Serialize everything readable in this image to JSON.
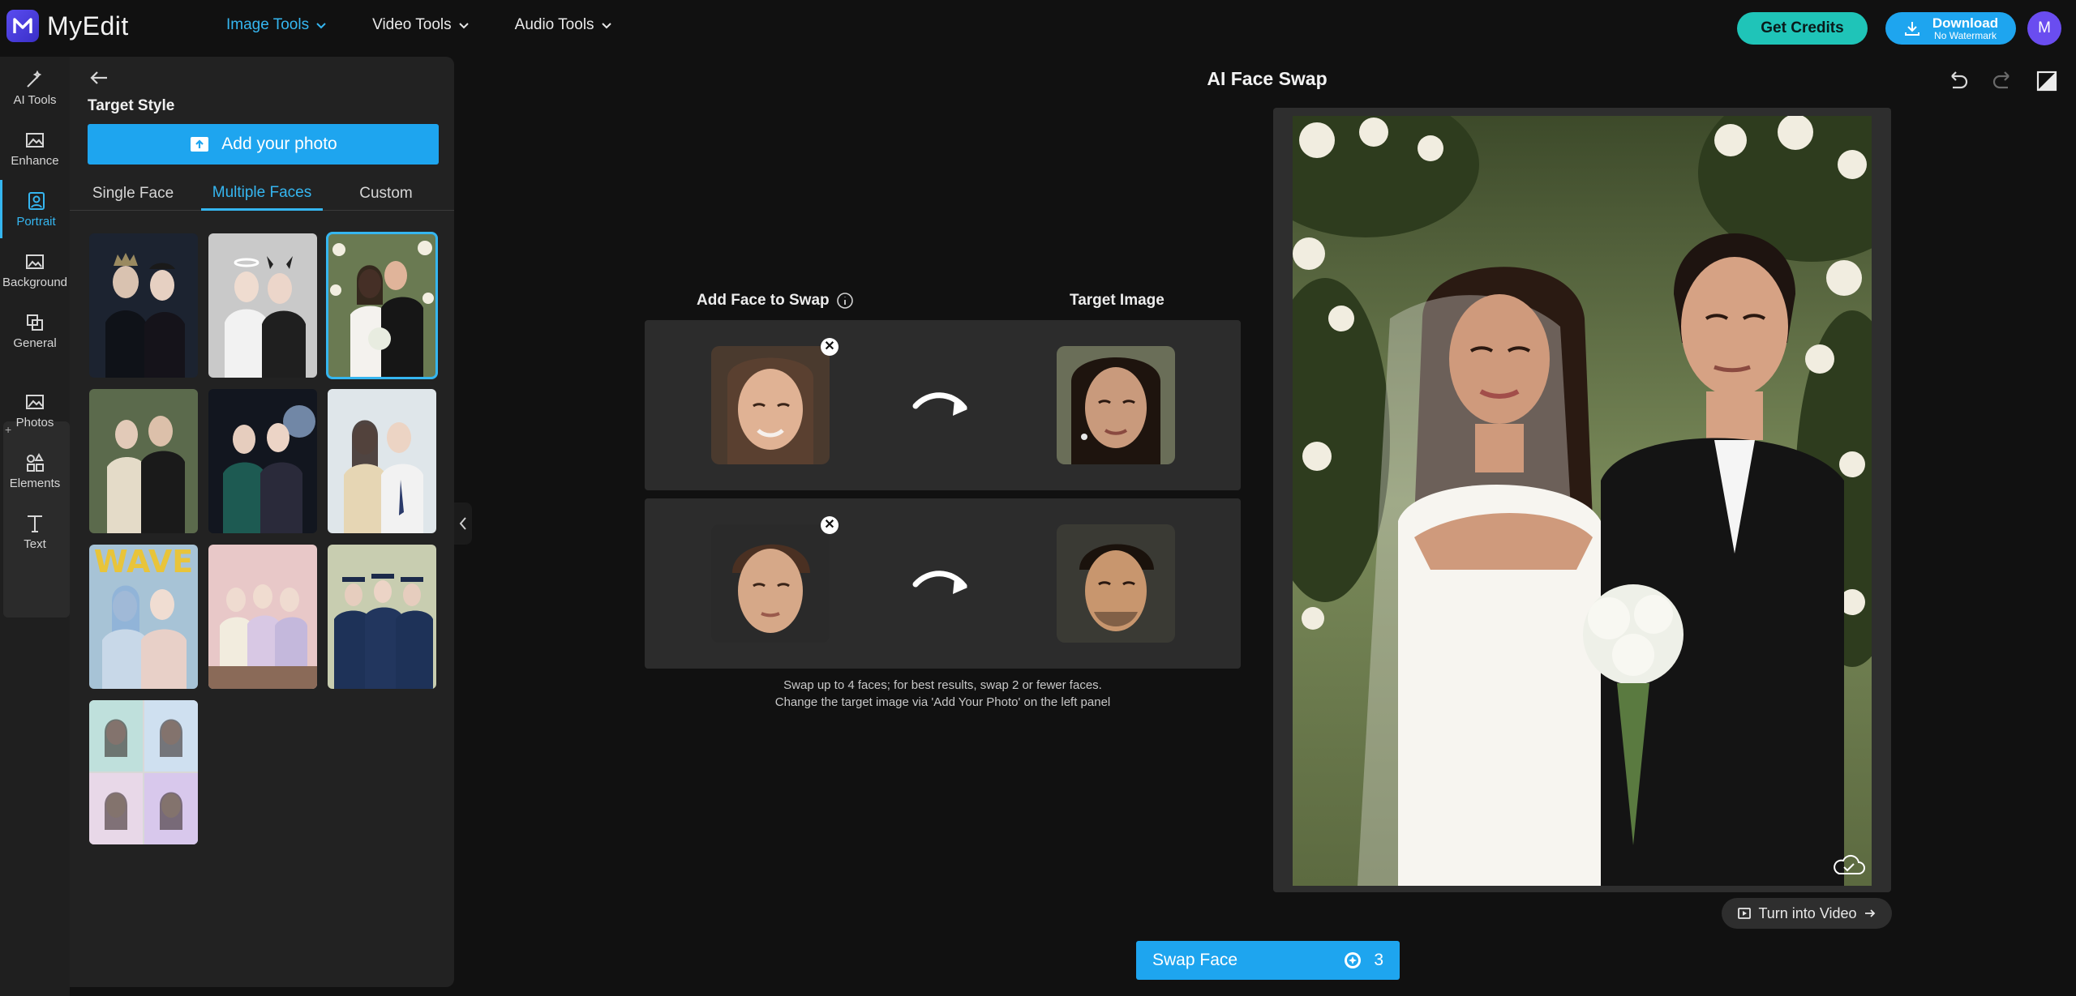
{
  "app": {
    "name": "MyEdit",
    "avatar_initial": "M"
  },
  "topnav": [
    {
      "label": "Image Tools",
      "active": true
    },
    {
      "label": "Video Tools",
      "active": false
    },
    {
      "label": "Audio Tools",
      "active": false
    }
  ],
  "header_actions": {
    "credits_label": "Get Credits",
    "download_label": "Download",
    "download_sublabel": "No Watermark"
  },
  "rail": [
    {
      "label": "AI Tools",
      "icon": "magic-wand-icon"
    },
    {
      "label": "Enhance",
      "icon": "enhance-image-icon"
    },
    {
      "label": "Portrait",
      "icon": "portrait-icon",
      "active": true
    },
    {
      "label": "Background",
      "icon": "background-icon"
    },
    {
      "label": "General",
      "icon": "general-icon"
    },
    {
      "label": "Photos",
      "icon": "photos-icon"
    },
    {
      "label": "Elements",
      "icon": "elements-icon"
    },
    {
      "label": "Text",
      "icon": "text-icon"
    }
  ],
  "rail_plus": "+",
  "panel": {
    "title": "Target Style",
    "add_photo_label": "Add your photo",
    "tabs": [
      {
        "label": "Single Face"
      },
      {
        "label": "Multiple Faces",
        "active": true
      },
      {
        "label": "Custom"
      }
    ],
    "thumbnails": [
      {
        "name": "dark-royal-couple"
      },
      {
        "name": "angel-devil-pair"
      },
      {
        "name": "wedding-couple",
        "selected": true
      },
      {
        "name": "vintage-couple"
      },
      {
        "name": "party-friends"
      },
      {
        "name": "school-uniform-pair"
      },
      {
        "name": "wave-group",
        "caption": "WAVE"
      },
      {
        "name": "schoolgirls-group"
      },
      {
        "name": "graduation-group"
      },
      {
        "name": "photo-booth-grid"
      }
    ]
  },
  "workspace": {
    "title": "AI Face Swap",
    "col_face": "Add Face to Swap",
    "col_target": "Target Image",
    "hint_line1": "Swap up to 4 faces; for best results, swap 2 or fewer faces.",
    "hint_line2": "Change the target image via 'Add Your Photo' on the left panel",
    "remove_glyph": "✕"
  },
  "preview_actions": {
    "turn_video_label": "Turn into Video",
    "swap_label": "Swap Face",
    "swap_cost": "3"
  },
  "colors": {
    "accent": "#1ea5ef",
    "credits": "#1fc4b8",
    "avatar": "#6a4df0"
  }
}
